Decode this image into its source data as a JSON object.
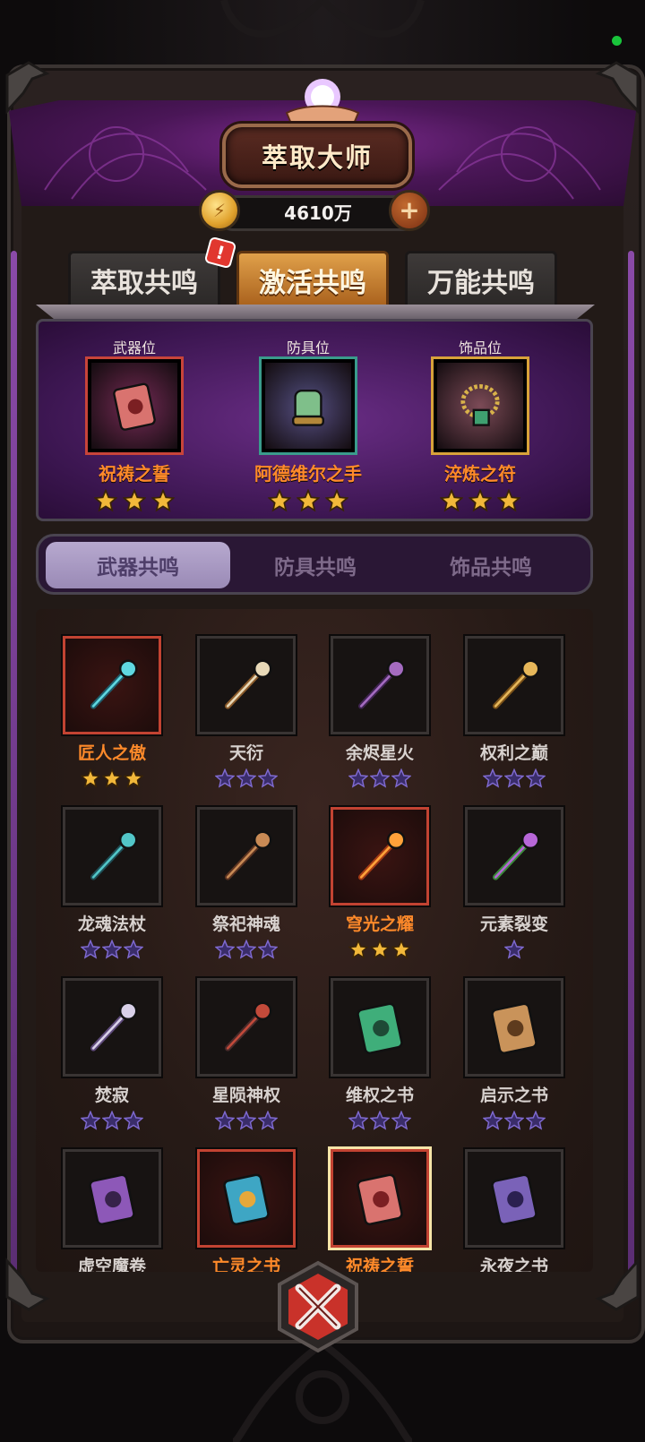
{
  "title": "萃取大师",
  "currency": {
    "icon": "gold-coin-icon",
    "value": "4610万",
    "add_icon": "plus-icon"
  },
  "tabs": [
    {
      "label": "萃取共鸣",
      "active": false,
      "badge": "!"
    },
    {
      "label": "激活共鸣",
      "active": true
    },
    {
      "label": "万能共鸣",
      "active": false
    }
  ],
  "slots": [
    {
      "category": "武器位",
      "name": "祝祷之誓",
      "stars": 3,
      "icon": "red-book-icon",
      "color": "#c8443a"
    },
    {
      "category": "防具位",
      "name": "阿德维尔之手",
      "stars": 3,
      "icon": "green-gauntlet-icon",
      "color": "#3a9b8c"
    },
    {
      "category": "饰品位",
      "name": "淬炼之符",
      "stars": 3,
      "icon": "bead-amulet-icon",
      "color": "#d8a23a"
    }
  ],
  "sub_tabs": [
    {
      "label": "武器共鸣",
      "active": true
    },
    {
      "label": "防具共鸣",
      "active": false
    },
    {
      "label": "饰品共鸣",
      "active": false
    }
  ],
  "items": [
    {
      "name": "匠人之傲",
      "owned": true,
      "stars": 3,
      "star_type": "gold",
      "icon": "crystal-claw-icon"
    },
    {
      "name": "天衍",
      "owned": false,
      "stars": 3,
      "star_type": "empty",
      "icon": "scroll-spear-icon"
    },
    {
      "name": "余烬星火",
      "owned": false,
      "stars": 3,
      "star_type": "empty",
      "icon": "dark-staff-icon"
    },
    {
      "name": "权利之巅",
      "owned": false,
      "stars": 3,
      "star_type": "empty",
      "icon": "golden-scepter-icon"
    },
    {
      "name": "龙魂法杖",
      "owned": false,
      "stars": 3,
      "star_type": "empty",
      "icon": "dragon-staff-icon"
    },
    {
      "name": "祭祀神魂",
      "owned": false,
      "stars": 3,
      "star_type": "empty",
      "icon": "bird-staff-icon"
    },
    {
      "name": "穹光之耀",
      "owned": true,
      "stars": 3,
      "star_type": "gold",
      "icon": "flame-trident-icon"
    },
    {
      "name": "元素裂变",
      "owned": false,
      "stars": 1,
      "star_type": "empty",
      "icon": "element-sword-icon"
    },
    {
      "name": "焚寂",
      "owned": false,
      "stars": 3,
      "star_type": "empty",
      "icon": "trident-staff-icon"
    },
    {
      "name": "星陨神权",
      "owned": false,
      "stars": 3,
      "star_type": "empty",
      "icon": "meteor-mace-icon"
    },
    {
      "name": "维权之书",
      "owned": false,
      "stars": 3,
      "star_type": "empty",
      "icon": "green-book-icon"
    },
    {
      "name": "启示之书",
      "owned": false,
      "stars": 3,
      "star_type": "empty",
      "icon": "bronze-book-icon"
    },
    {
      "name": "虚空魔卷",
      "owned": false,
      "stars": 0,
      "star_type": "empty",
      "icon": "void-book-icon"
    },
    {
      "name": "亡灵之书",
      "owned": true,
      "stars": 0,
      "star_type": "gold",
      "icon": "teal-book-icon"
    },
    {
      "name": "祝祷之誓",
      "owned": true,
      "selected": true,
      "stars": 0,
      "star_type": "gold",
      "icon": "red-book-icon"
    },
    {
      "name": "永夜之书",
      "owned": false,
      "stars": 0,
      "star_type": "empty",
      "icon": "purple-book-icon"
    }
  ],
  "close_button": {
    "icon": "close-x-icon"
  }
}
